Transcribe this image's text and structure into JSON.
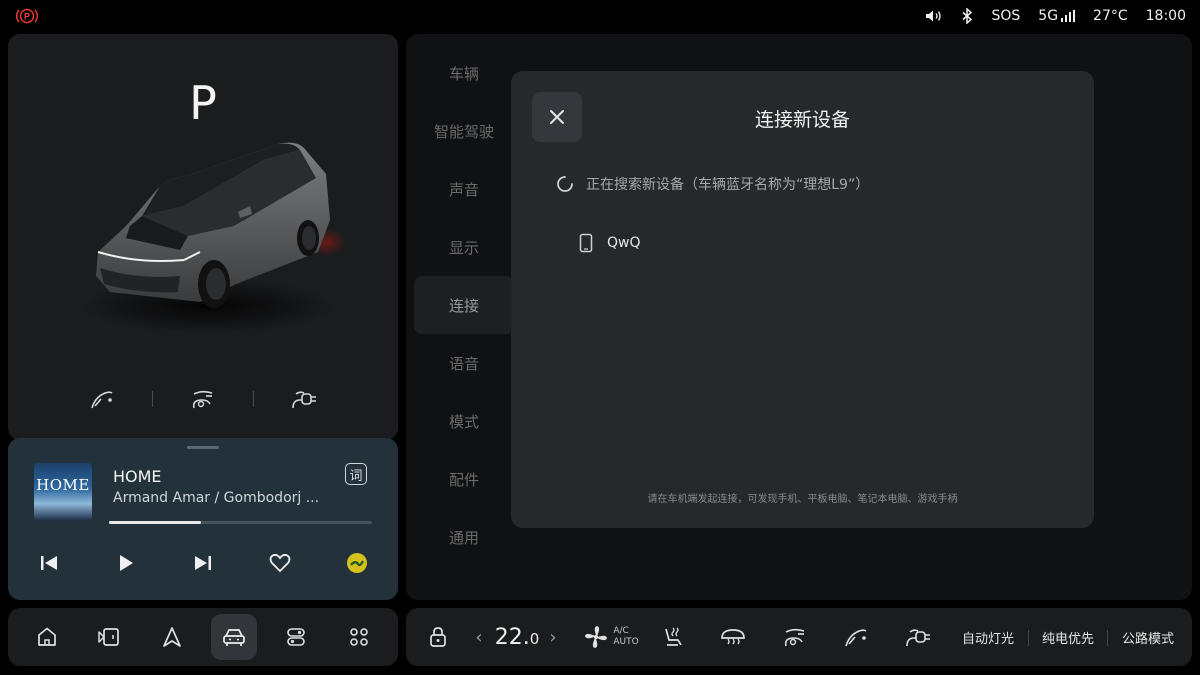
{
  "status_bar": {
    "parking_icon": "parking-brake-warning-icon",
    "volume_icon": "volume-icon",
    "bluetooth_icon": "bluetooth-icon",
    "sos": "SOS",
    "network": "5G",
    "signal_icon": "signal-bars-icon",
    "temperature": "27°C",
    "time": "18:00",
    "warning_color": "#e53935"
  },
  "car_panel": {
    "gear": "P",
    "actions": [
      "fuel-door-icon",
      "charge-door-left-icon",
      "charge-plug-icon"
    ]
  },
  "music": {
    "album_art_text": "HOME",
    "title": "HOME",
    "artist": "Armand Amar / Gombodorj ...",
    "lyrics_button": "词",
    "progress": 0.35,
    "controls": [
      "previous-icon",
      "play-icon",
      "next-icon",
      "favorite-icon",
      "music-app-icon"
    ],
    "app_icon_color": "#d4c21a"
  },
  "dock": {
    "items": [
      "home-icon",
      "media-icon",
      "navigation-icon",
      "car-icon",
      "apps-toggle-icon",
      "grid-icon"
    ],
    "active_index": 3
  },
  "climate": {
    "temperature_whole": "22.",
    "temperature_decimal": "0",
    "ac_label": "A/C",
    "auto_label": "AUTO",
    "modes": [
      "自动灯光",
      "纯电优先",
      "公路模式"
    ]
  },
  "settings": {
    "nav": [
      "车辆",
      "智能驾驶",
      "声音",
      "显示",
      "连接",
      "语音",
      "模式",
      "配件",
      "通用"
    ],
    "active_index": 4
  },
  "dialog": {
    "title": "连接新设备",
    "searching_text": "正在搜索新设备（车辆蓝牙名称为“理想L9”）",
    "devices": [
      {
        "name": "QwQ",
        "icon": "phone-icon"
      }
    ],
    "hint": "请在车机端发起连接，可发现手机、平板电脑、笔记本电脑、游戏手柄"
  }
}
